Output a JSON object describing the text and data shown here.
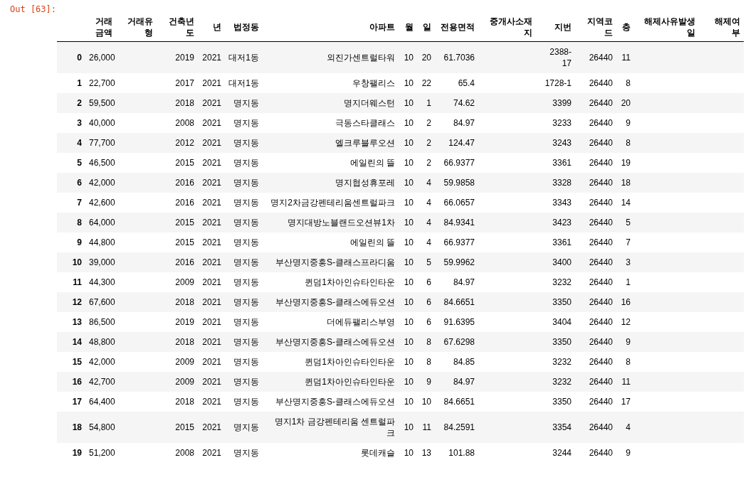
{
  "prompt": "Out [63]:",
  "columns": [
    "거래금액",
    "거래유형",
    "건축년도",
    "년",
    "법정동",
    "아파트",
    "월",
    "일",
    "전용면적",
    "중개사소재지",
    "지번",
    "지역코드",
    "층",
    "해제사유발생일",
    "해제여부"
  ],
  "rows": [
    {
      "index": "0",
      "cells": [
        "26,000",
        null,
        "2019",
        "2021",
        "대저1동",
        "외진가센트럴타워",
        "10",
        "20",
        "61.7036",
        null,
        "2388-17",
        "26440",
        "11",
        null,
        null
      ]
    },
    {
      "index": "1",
      "cells": [
        "22,700",
        null,
        "2017",
        "2021",
        "대저1동",
        "우창팰리스",
        "10",
        "22",
        "65.4",
        null,
        "1728-1",
        "26440",
        "8",
        null,
        null
      ]
    },
    {
      "index": "2",
      "cells": [
        "59,500",
        null,
        "2018",
        "2021",
        "명지동",
        "명지더웨스턴",
        "10",
        "1",
        "74.62",
        null,
        "3399",
        "26440",
        "20",
        null,
        null
      ]
    },
    {
      "index": "3",
      "cells": [
        "40,000",
        null,
        "2008",
        "2021",
        "명지동",
        "극동스타클래스",
        "10",
        "2",
        "84.97",
        null,
        "3233",
        "26440",
        "9",
        null,
        null
      ]
    },
    {
      "index": "4",
      "cells": [
        "77,700",
        null,
        "2012",
        "2021",
        "명지동",
        "엘크루블루오션",
        "10",
        "2",
        "124.47",
        null,
        "3243",
        "26440",
        "8",
        null,
        null
      ]
    },
    {
      "index": "5",
      "cells": [
        "46,500",
        null,
        "2015",
        "2021",
        "명지동",
        "에일린의 뜰",
        "10",
        "2",
        "66.9377",
        null,
        "3361",
        "26440",
        "19",
        null,
        null
      ]
    },
    {
      "index": "6",
      "cells": [
        "42,000",
        null,
        "2016",
        "2021",
        "명지동",
        "명지협성휴포레",
        "10",
        "4",
        "59.9858",
        null,
        "3328",
        "26440",
        "18",
        null,
        null
      ]
    },
    {
      "index": "7",
      "cells": [
        "42,600",
        null,
        "2016",
        "2021",
        "명지동",
        "명지2차금강펜테리움센트럴파크",
        "10",
        "4",
        "66.0657",
        null,
        "3343",
        "26440",
        "14",
        null,
        null
      ]
    },
    {
      "index": "8",
      "cells": [
        "64,000",
        null,
        "2015",
        "2021",
        "명지동",
        "명지대방노블랜드오션뷰1차",
        "10",
        "4",
        "84.9341",
        null,
        "3423",
        "26440",
        "5",
        null,
        null
      ]
    },
    {
      "index": "9",
      "cells": [
        "44,800",
        null,
        "2015",
        "2021",
        "명지동",
        "에일린의 뜰",
        "10",
        "4",
        "66.9377",
        null,
        "3361",
        "26440",
        "7",
        null,
        null
      ]
    },
    {
      "index": "10",
      "cells": [
        "39,000",
        null,
        "2016",
        "2021",
        "명지동",
        "부산명지중흥S-클래스프라디움",
        "10",
        "5",
        "59.9962",
        null,
        "3400",
        "26440",
        "3",
        null,
        null
      ]
    },
    {
      "index": "11",
      "cells": [
        "44,300",
        null,
        "2009",
        "2021",
        "명지동",
        "퀸덤1차아인슈타인타운",
        "10",
        "6",
        "84.97",
        null,
        "3232",
        "26440",
        "1",
        null,
        null
      ]
    },
    {
      "index": "12",
      "cells": [
        "67,600",
        null,
        "2018",
        "2021",
        "명지동",
        "부산명지중흥S-클래스에듀오션",
        "10",
        "6",
        "84.6651",
        null,
        "3350",
        "26440",
        "16",
        null,
        null
      ]
    },
    {
      "index": "13",
      "cells": [
        "86,500",
        null,
        "2019",
        "2021",
        "명지동",
        "더에듀팰리스부영",
        "10",
        "6",
        "91.6395",
        null,
        "3404",
        "26440",
        "12",
        null,
        null
      ]
    },
    {
      "index": "14",
      "cells": [
        "48,800",
        null,
        "2018",
        "2021",
        "명지동",
        "부산명지중흥S-클래스에듀오션",
        "10",
        "8",
        "67.6298",
        null,
        "3350",
        "26440",
        "9",
        null,
        null
      ]
    },
    {
      "index": "15",
      "cells": [
        "42,000",
        null,
        "2009",
        "2021",
        "명지동",
        "퀸덤1차아인슈타인타운",
        "10",
        "8",
        "84.85",
        null,
        "3232",
        "26440",
        "8",
        null,
        null
      ]
    },
    {
      "index": "16",
      "cells": [
        "42,700",
        null,
        "2009",
        "2021",
        "명지동",
        "퀸덤1차아인슈타인타운",
        "10",
        "9",
        "84.97",
        null,
        "3232",
        "26440",
        "11",
        null,
        null
      ]
    },
    {
      "index": "17",
      "cells": [
        "64,400",
        null,
        "2018",
        "2021",
        "명지동",
        "부산명지중흥S-클래스에듀오션",
        "10",
        "10",
        "84.6651",
        null,
        "3350",
        "26440",
        "17",
        null,
        null
      ]
    },
    {
      "index": "18",
      "cells": [
        "54,800",
        null,
        "2015",
        "2021",
        "명지동",
        "명지1차 금강펜테리움 센트럴파크",
        "10",
        "11",
        "84.2591",
        null,
        "3354",
        "26440",
        "4",
        null,
        null
      ]
    },
    {
      "index": "19",
      "cells": [
        "51,200",
        null,
        "2008",
        "2021",
        "명지동",
        "롯데캐슬",
        "10",
        "13",
        "101.88",
        null,
        "3244",
        "26440",
        "9",
        null,
        null
      ]
    }
  ]
}
